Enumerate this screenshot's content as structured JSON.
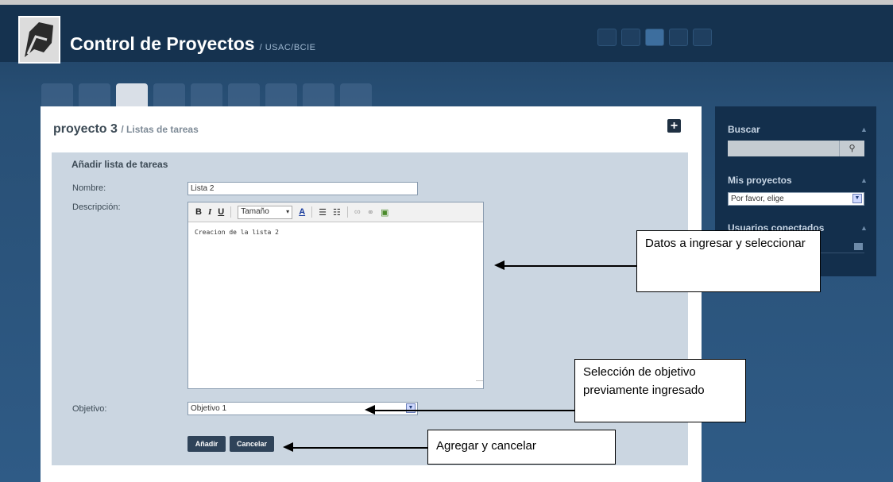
{
  "header": {
    "title": "Control de Proyectos",
    "subtitle": "/ USAC/BCIE",
    "icons": [
      "monitor-icon",
      "user-icon",
      "globe-icon",
      "wrench-icon",
      "power-icon"
    ]
  },
  "tabs": [
    "help-tab",
    "calendar-tab",
    "tasklist-tab",
    "notes-tab",
    "files-tab",
    "document-tab",
    "milestones-tab",
    "budget-tab",
    "clipboard-tab"
  ],
  "page": {
    "project": "proyecto 3",
    "crumb": "/ Listas de tareas"
  },
  "form": {
    "title": "Añadir lista de tareas",
    "name_label": "Nombre:",
    "name_value": "Lista 2",
    "desc_label": "Descripción:",
    "size_label": "Tamaño",
    "desc_value": "Creacion de la lista 2",
    "objective_label": "Objetivo:",
    "objective_value": "Objetivo 1",
    "add_label": "Añadir",
    "cancel_label": "Cancelar"
  },
  "sidebar": {
    "search_title": "Buscar",
    "projects_title": "Mis proyectos",
    "projects_value": "Por favor, elige",
    "users_title": "Usuarios conectados"
  },
  "callouts": {
    "data": "Datos a ingresar y seleccionar",
    "objective": "Selección de objetivo previamente ingresado",
    "buttons": "Agregar y cancelar"
  }
}
